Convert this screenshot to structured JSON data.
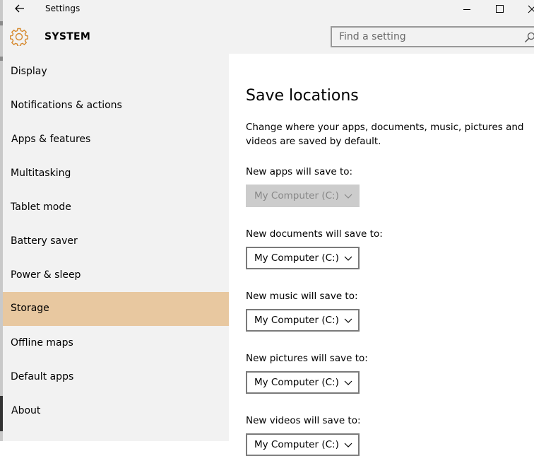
{
  "window": {
    "title": "Settings"
  },
  "header": {
    "section": "SYSTEM",
    "search_placeholder": "Find a setting"
  },
  "sidebar": {
    "items": [
      {
        "label": "Display"
      },
      {
        "label": "Notifications & actions"
      },
      {
        "label": "Apps & features"
      },
      {
        "label": "Multitasking"
      },
      {
        "label": "Tablet mode"
      },
      {
        "label": "Battery saver"
      },
      {
        "label": "Power & sleep"
      },
      {
        "label": "Storage",
        "selected": true
      },
      {
        "label": "Offline maps"
      },
      {
        "label": "Default apps"
      },
      {
        "label": "About"
      }
    ]
  },
  "main": {
    "title": "Save locations",
    "description": "Change where your apps, documents, music, pictures and videos are saved by default.",
    "settings": [
      {
        "label": "New apps will save to:",
        "value": "My Computer (C:)",
        "disabled": true
      },
      {
        "label": "New documents will save to:",
        "value": "My Computer (C:)"
      },
      {
        "label": "New music will save to:",
        "value": "My Computer (C:)"
      },
      {
        "label": "New pictures will save to:",
        "value": "My Computer (C:)"
      },
      {
        "label": "New videos will save to:",
        "value": "My Computer (C:)"
      }
    ]
  },
  "colors": {
    "accent": "#e8c8a0",
    "gear": "#d68a2f",
    "sidebar_bg": "#f2f2f2"
  }
}
